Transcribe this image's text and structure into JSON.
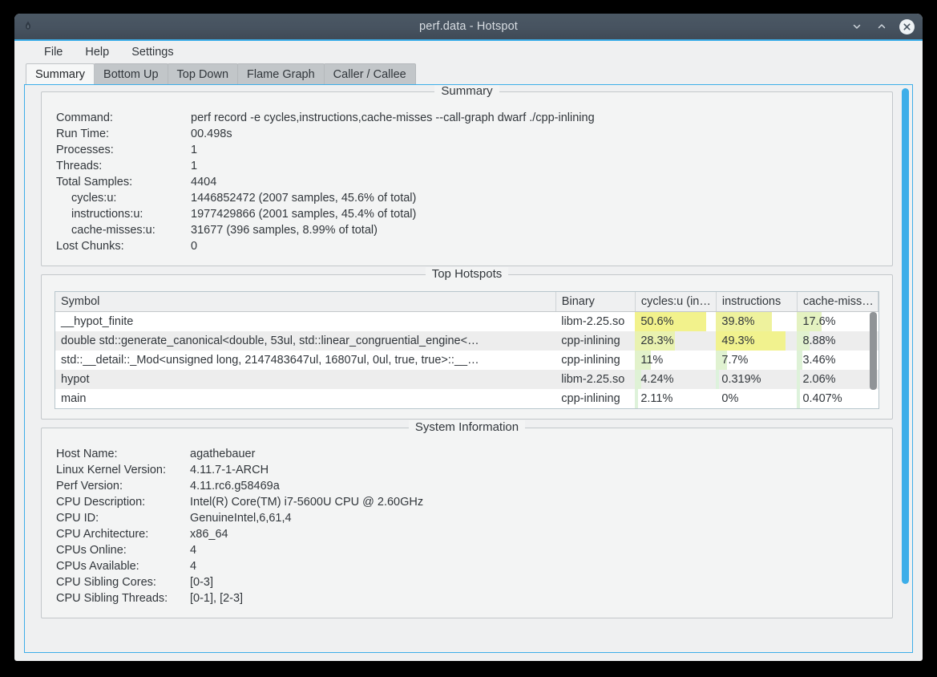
{
  "window": {
    "title": "perf.data - Hotspot",
    "app_icon": "flame-icon",
    "controls": {
      "minimize": "⌄",
      "maximize": "⌃",
      "close": "✕"
    }
  },
  "menubar": {
    "items": [
      {
        "label": "File"
      },
      {
        "label": "Help"
      },
      {
        "label": "Settings"
      }
    ]
  },
  "tabs": [
    {
      "label": "Summary",
      "active": true
    },
    {
      "label": "Bottom Up",
      "active": false
    },
    {
      "label": "Top Down",
      "active": false
    },
    {
      "label": "Flame Graph",
      "active": false
    },
    {
      "label": "Caller / Callee",
      "active": false
    }
  ],
  "summary": {
    "title": "Summary",
    "rows": [
      {
        "key": "Command:",
        "value": "perf record -e cycles,instructions,cache-misses --call-graph dwarf ./cpp-inlining",
        "indent": false
      },
      {
        "key": "Run Time:",
        "value": "00.498s",
        "indent": false
      },
      {
        "key": "Processes:",
        "value": "1",
        "indent": false
      },
      {
        "key": "Threads:",
        "value": "1",
        "indent": false
      },
      {
        "key": "Total Samples:",
        "value": "4404",
        "indent": false
      },
      {
        "key": "cycles:u:",
        "value": "1446852472 (2007 samples, 45.6% of total)",
        "indent": true
      },
      {
        "key": "instructions:u:",
        "value": "1977429866 (2001 samples, 45.4% of total)",
        "indent": true
      },
      {
        "key": "cache-misses:u:",
        "value": "31677 (396 samples, 8.99% of total)",
        "indent": true
      },
      {
        "key": "Lost Chunks:",
        "value": "0",
        "indent": false
      }
    ]
  },
  "hotspots": {
    "title": "Top Hotspots",
    "columns": [
      "Symbol",
      "Binary",
      "cycles:u (in…",
      "instructions",
      "cache-miss…"
    ],
    "rows": [
      {
        "symbol": "__hypot_finite",
        "binary": "libm-2.25.so",
        "cycles": "50.6%",
        "cycles_pct": 50.6,
        "instructions": "39.8%",
        "instructions_pct": 39.8,
        "cache_misses": "17.6%",
        "cache_misses_pct": 17.6
      },
      {
        "symbol": "double std::generate_canonical<double, 53ul, std::linear_congruential_engine<…",
        "binary": "cpp-inlining",
        "cycles": "28.3%",
        "cycles_pct": 28.3,
        "instructions": "49.3%",
        "instructions_pct": 49.3,
        "cache_misses": "8.88%",
        "cache_misses_pct": 8.88
      },
      {
        "symbol": "std::__detail::_Mod<unsigned long, 2147483647ul, 16807ul, 0ul, true, true>::__…",
        "binary": "cpp-inlining",
        "cycles": "11%",
        "cycles_pct": 11,
        "instructions": "7.7%",
        "instructions_pct": 7.7,
        "cache_misses": "3.46%",
        "cache_misses_pct": 3.46
      },
      {
        "symbol": "hypot",
        "binary": "libm-2.25.so",
        "cycles": "4.24%",
        "cycles_pct": 4.24,
        "instructions": "0.319%",
        "instructions_pct": 0.319,
        "cache_misses": "2.06%",
        "cache_misses_pct": 2.06
      },
      {
        "symbol": "main",
        "binary": "cpp-inlining",
        "cycles": "2.11%",
        "cycles_pct": 2.11,
        "instructions": "0%",
        "instructions_pct": 0,
        "cache_misses": "0.407%",
        "cache_misses_pct": 0.407
      }
    ]
  },
  "sysinfo": {
    "title": "System Information",
    "rows": [
      {
        "key": "Host Name:",
        "value": "agathebauer"
      },
      {
        "key": "Linux Kernel Version:",
        "value": "4.11.7-1-ARCH"
      },
      {
        "key": "Perf Version:",
        "value": "4.11.rc6.g58469a"
      },
      {
        "key": "CPU Description:",
        "value": "Intel(R) Core(TM) i7-5600U CPU @ 2.60GHz"
      },
      {
        "key": "CPU ID:",
        "value": "GenuineIntel,6,61,4"
      },
      {
        "key": "CPU Architecture:",
        "value": "x86_64"
      },
      {
        "key": "CPUs Online:",
        "value": "4"
      },
      {
        "key": "CPUs Available:",
        "value": "4"
      },
      {
        "key": "CPU Sibling Cores:",
        "value": "[0-3]"
      },
      {
        "key": "CPU Sibling Threads:",
        "value": "[0-1], [2-3]"
      }
    ]
  },
  "colors": {
    "accent": "#3daee9",
    "titlebar": "#475360",
    "heat_high": "#f2f291",
    "heat_low": "#ddf2dd",
    "window_bg": "#eff0f1"
  }
}
